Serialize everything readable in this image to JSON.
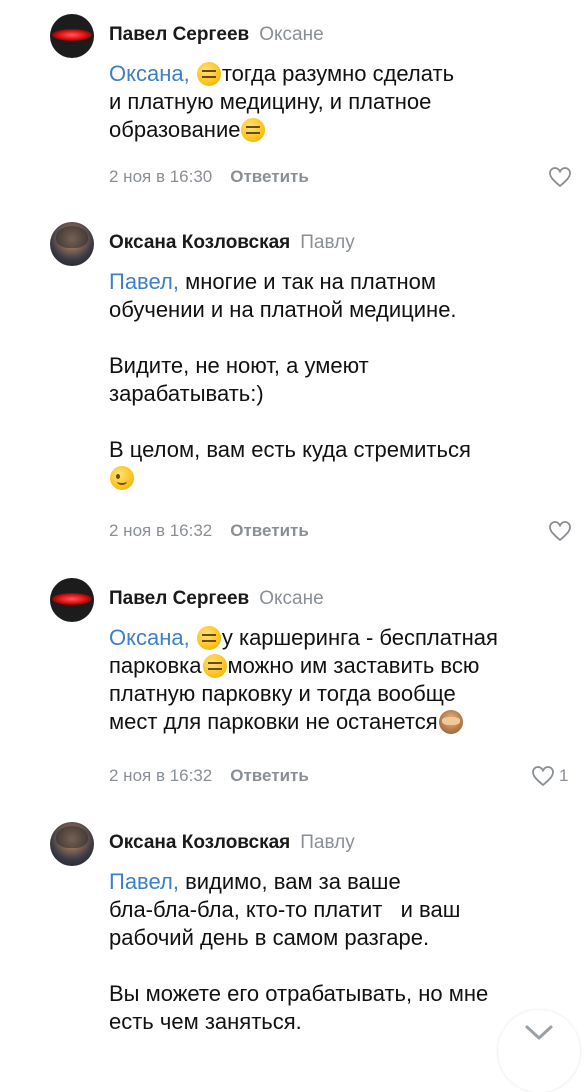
{
  "comments": [
    {
      "author": "Павел Сергеев",
      "reply_to": "Оксане",
      "mention": "Оксана,",
      "paragraphs": [
        [
          "тогда разумно сделать",
          "и платную медицину, и платное",
          "образование"
        ]
      ],
      "date": "2 ноя в 16:30",
      "reply_label": "Ответить",
      "likes": ""
    },
    {
      "author": "Оксана Козловская",
      "reply_to": "Павлу",
      "mention": "Павел,",
      "paragraphs": [
        [
          "многие и так на платном",
          "обучении и на платной медицине."
        ],
        [
          "Видите, не ноют, а умеют",
          "зарабатывать:)"
        ],
        [
          "В целом, вам есть куда стремиться"
        ]
      ],
      "date": "2 ноя в 16:32",
      "reply_label": "Ответить",
      "likes": ""
    },
    {
      "author": "Павел Сергеев",
      "reply_to": "Оксане",
      "mention": "Оксана,",
      "paragraphs": [
        [
          "у каршеринга - бесплатная",
          "парковка",
          "можно им заставить всю",
          "платную парковку и тогда вообще",
          "мест для парковки не останется"
        ]
      ],
      "date": "2 ноя в 16:32",
      "reply_label": "Ответить",
      "likes": "1"
    },
    {
      "author": "Оксана Козловская",
      "reply_to": "Павлу",
      "mention": "Павел,",
      "paragraphs": [
        [
          "видимо, вам за ваше",
          "бла-бла-бла, кто-то платит   и ваш",
          "рабочий день в самом разгаре."
        ],
        [
          "Вы можете его отрабатывать, но мне",
          "есть чем заняться."
        ]
      ],
      "date": "",
      "reply_label": "",
      "likes": ""
    }
  ],
  "icons": {
    "like": "heart-outline-icon",
    "emoji_neutral": "expressionless-face-icon",
    "emoji_wink": "winking-face-icon",
    "emoji_monkey": "see-no-evil-monkey-icon",
    "scroll": "chevron-down-icon"
  },
  "colors": {
    "mention": "#3f7fc6",
    "secondary": "#8a8f96",
    "text": "#111111"
  }
}
